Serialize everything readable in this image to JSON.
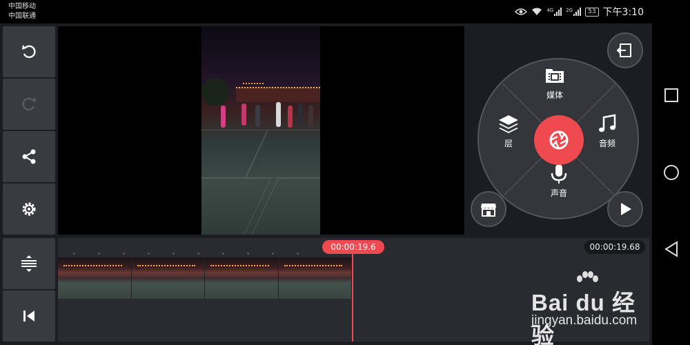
{
  "status_bar": {
    "carrier_1": "中国移动",
    "carrier_2": "中国联通",
    "network_1": "4G",
    "network_2": "2G",
    "battery": "53",
    "time": "下午3:10"
  },
  "left_toolbar": {
    "items": [
      {
        "name": "undo",
        "icon": "undo-icon"
      },
      {
        "name": "redo",
        "icon": "redo-icon",
        "disabled": true
      },
      {
        "name": "share",
        "icon": "share-icon"
      },
      {
        "name": "settings",
        "icon": "gear-icon"
      }
    ],
    "bottom_items": [
      {
        "name": "timeline-expand",
        "icon": "expand-tracks-icon"
      },
      {
        "name": "jump-to-start",
        "icon": "skip-to-start-icon"
      }
    ]
  },
  "media_wheel": {
    "media_label": "媒体",
    "audio_label": "音频",
    "voice_label": "声音",
    "layer_label": "层",
    "record_icon": "camera-shutter-icon",
    "record_color": "#ef4a4f"
  },
  "timeline": {
    "current_time": "00:00:19.6",
    "total_time": "00:00:19.68",
    "playhead_color": "#ef4a4f"
  },
  "watermark": {
    "brand": "Bai du 经验",
    "url": "jingyan.baidu.com"
  },
  "colors": {
    "accent": "#ef4a4f",
    "panel": "#3a3b41",
    "background": "#1c1d22"
  }
}
